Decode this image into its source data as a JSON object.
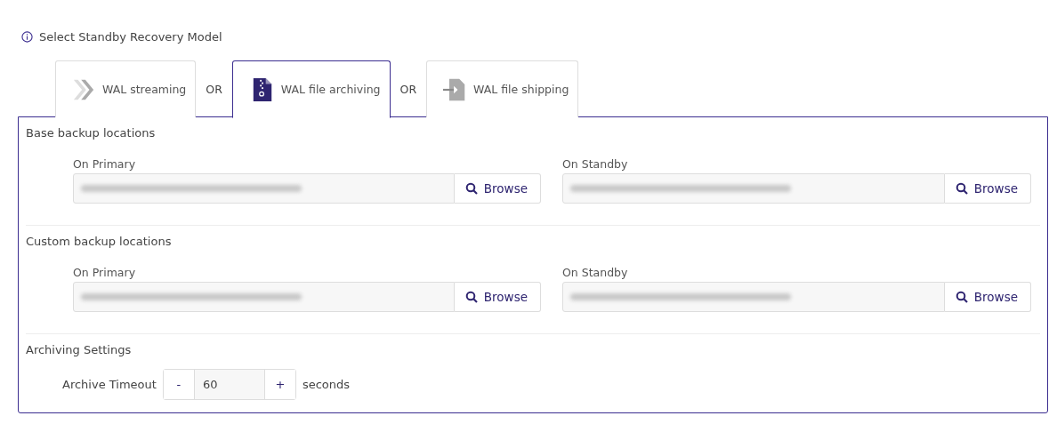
{
  "heading": "Select Standby Recovery Model",
  "tabs": [
    {
      "label": "WAL streaming",
      "kind": "streaming",
      "selected": false
    },
    {
      "label": "WAL file archiving",
      "kind": "archive",
      "selected": true
    },
    {
      "label": "WAL file shipping",
      "kind": "shipping",
      "selected": false
    }
  ],
  "separators": [
    "OR",
    "OR"
  ],
  "sections": [
    {
      "title": "Base backup locations",
      "fields": [
        {
          "label": "On Primary",
          "button": "Browse"
        },
        {
          "label": "On Standby",
          "button": "Browse"
        }
      ]
    },
    {
      "title": "Custom backup locations",
      "fields": [
        {
          "label": "On Primary",
          "button": "Browse"
        },
        {
          "label": "On Standby",
          "button": "Browse"
        }
      ]
    }
  ],
  "archiving": {
    "title": "Archiving Settings",
    "label": "Archive Timeout",
    "minus": "-",
    "value": "60",
    "plus": "+",
    "unit": "seconds"
  }
}
